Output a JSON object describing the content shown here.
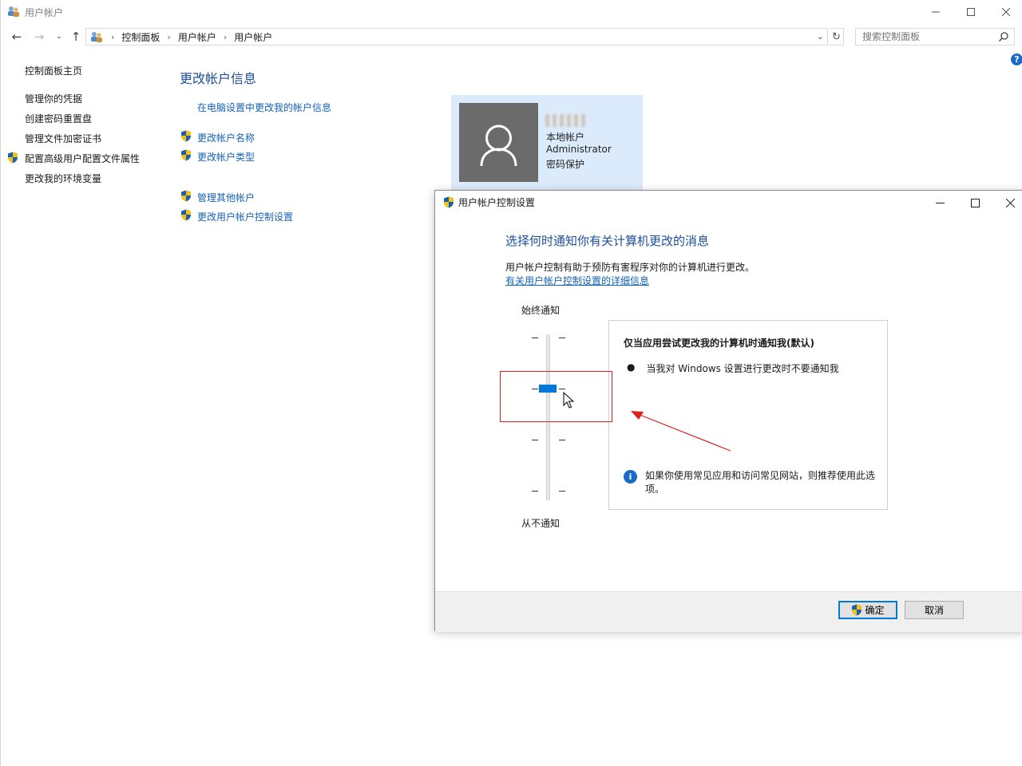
{
  "window": {
    "title": "用户帐户",
    "minimize_icon": "minimize-icon",
    "maximize_icon": "maximize-icon",
    "close_icon": "close-icon"
  },
  "navigation": {
    "breadcrumb": [
      "控制面板",
      "用户帐户",
      "用户帐户"
    ],
    "search_placeholder": "搜索控制面板"
  },
  "sidebar": {
    "home": "控制面板主页",
    "items": [
      {
        "label": "管理你的凭据",
        "shield": false
      },
      {
        "label": "创建密码重置盘",
        "shield": false
      },
      {
        "label": "管理文件加密证书",
        "shield": false
      },
      {
        "label": "配置高级用户配置文件属性",
        "shield": true
      },
      {
        "label": "更改我的环境变量",
        "shield": false
      }
    ]
  },
  "main": {
    "title": "更改帐户信息",
    "pc_settings_link": "在电脑设置中更改我的帐户信息",
    "links": [
      "更改帐户名称",
      "更改帐户类型",
      "管理其他帐户",
      "更改用户帐户控制设置"
    ]
  },
  "account": {
    "type": "本地帐户",
    "group": "Administrator",
    "password_status": "密码保护"
  },
  "uac_dialog": {
    "title": "用户帐户控制设置",
    "heading": "选择何时通知你有关计算机更改的消息",
    "description": "用户帐户控制有助于预防有害程序对你的计算机进行更改。",
    "details_link": "有关用户帐户控制设置的详细信息",
    "slider_top_label": "始终通知",
    "slider_bottom_label": "从不通知",
    "slider_level": 2,
    "slider_levels": 4,
    "info_title": "仅当应用尝试更改我的计算机时通知我(默认)",
    "info_bullet": "当我对 Windows 设置进行更改时不要通知我",
    "info_note": "如果你使用常见应用和访问常见网站，则推荐使用此选项。",
    "ok_label": "确定",
    "cancel_label": "取消"
  },
  "colors": {
    "accent": "#0078d7",
    "link": "#1462b8",
    "heading": "#1c4fa0",
    "annotation": "#e02020"
  }
}
